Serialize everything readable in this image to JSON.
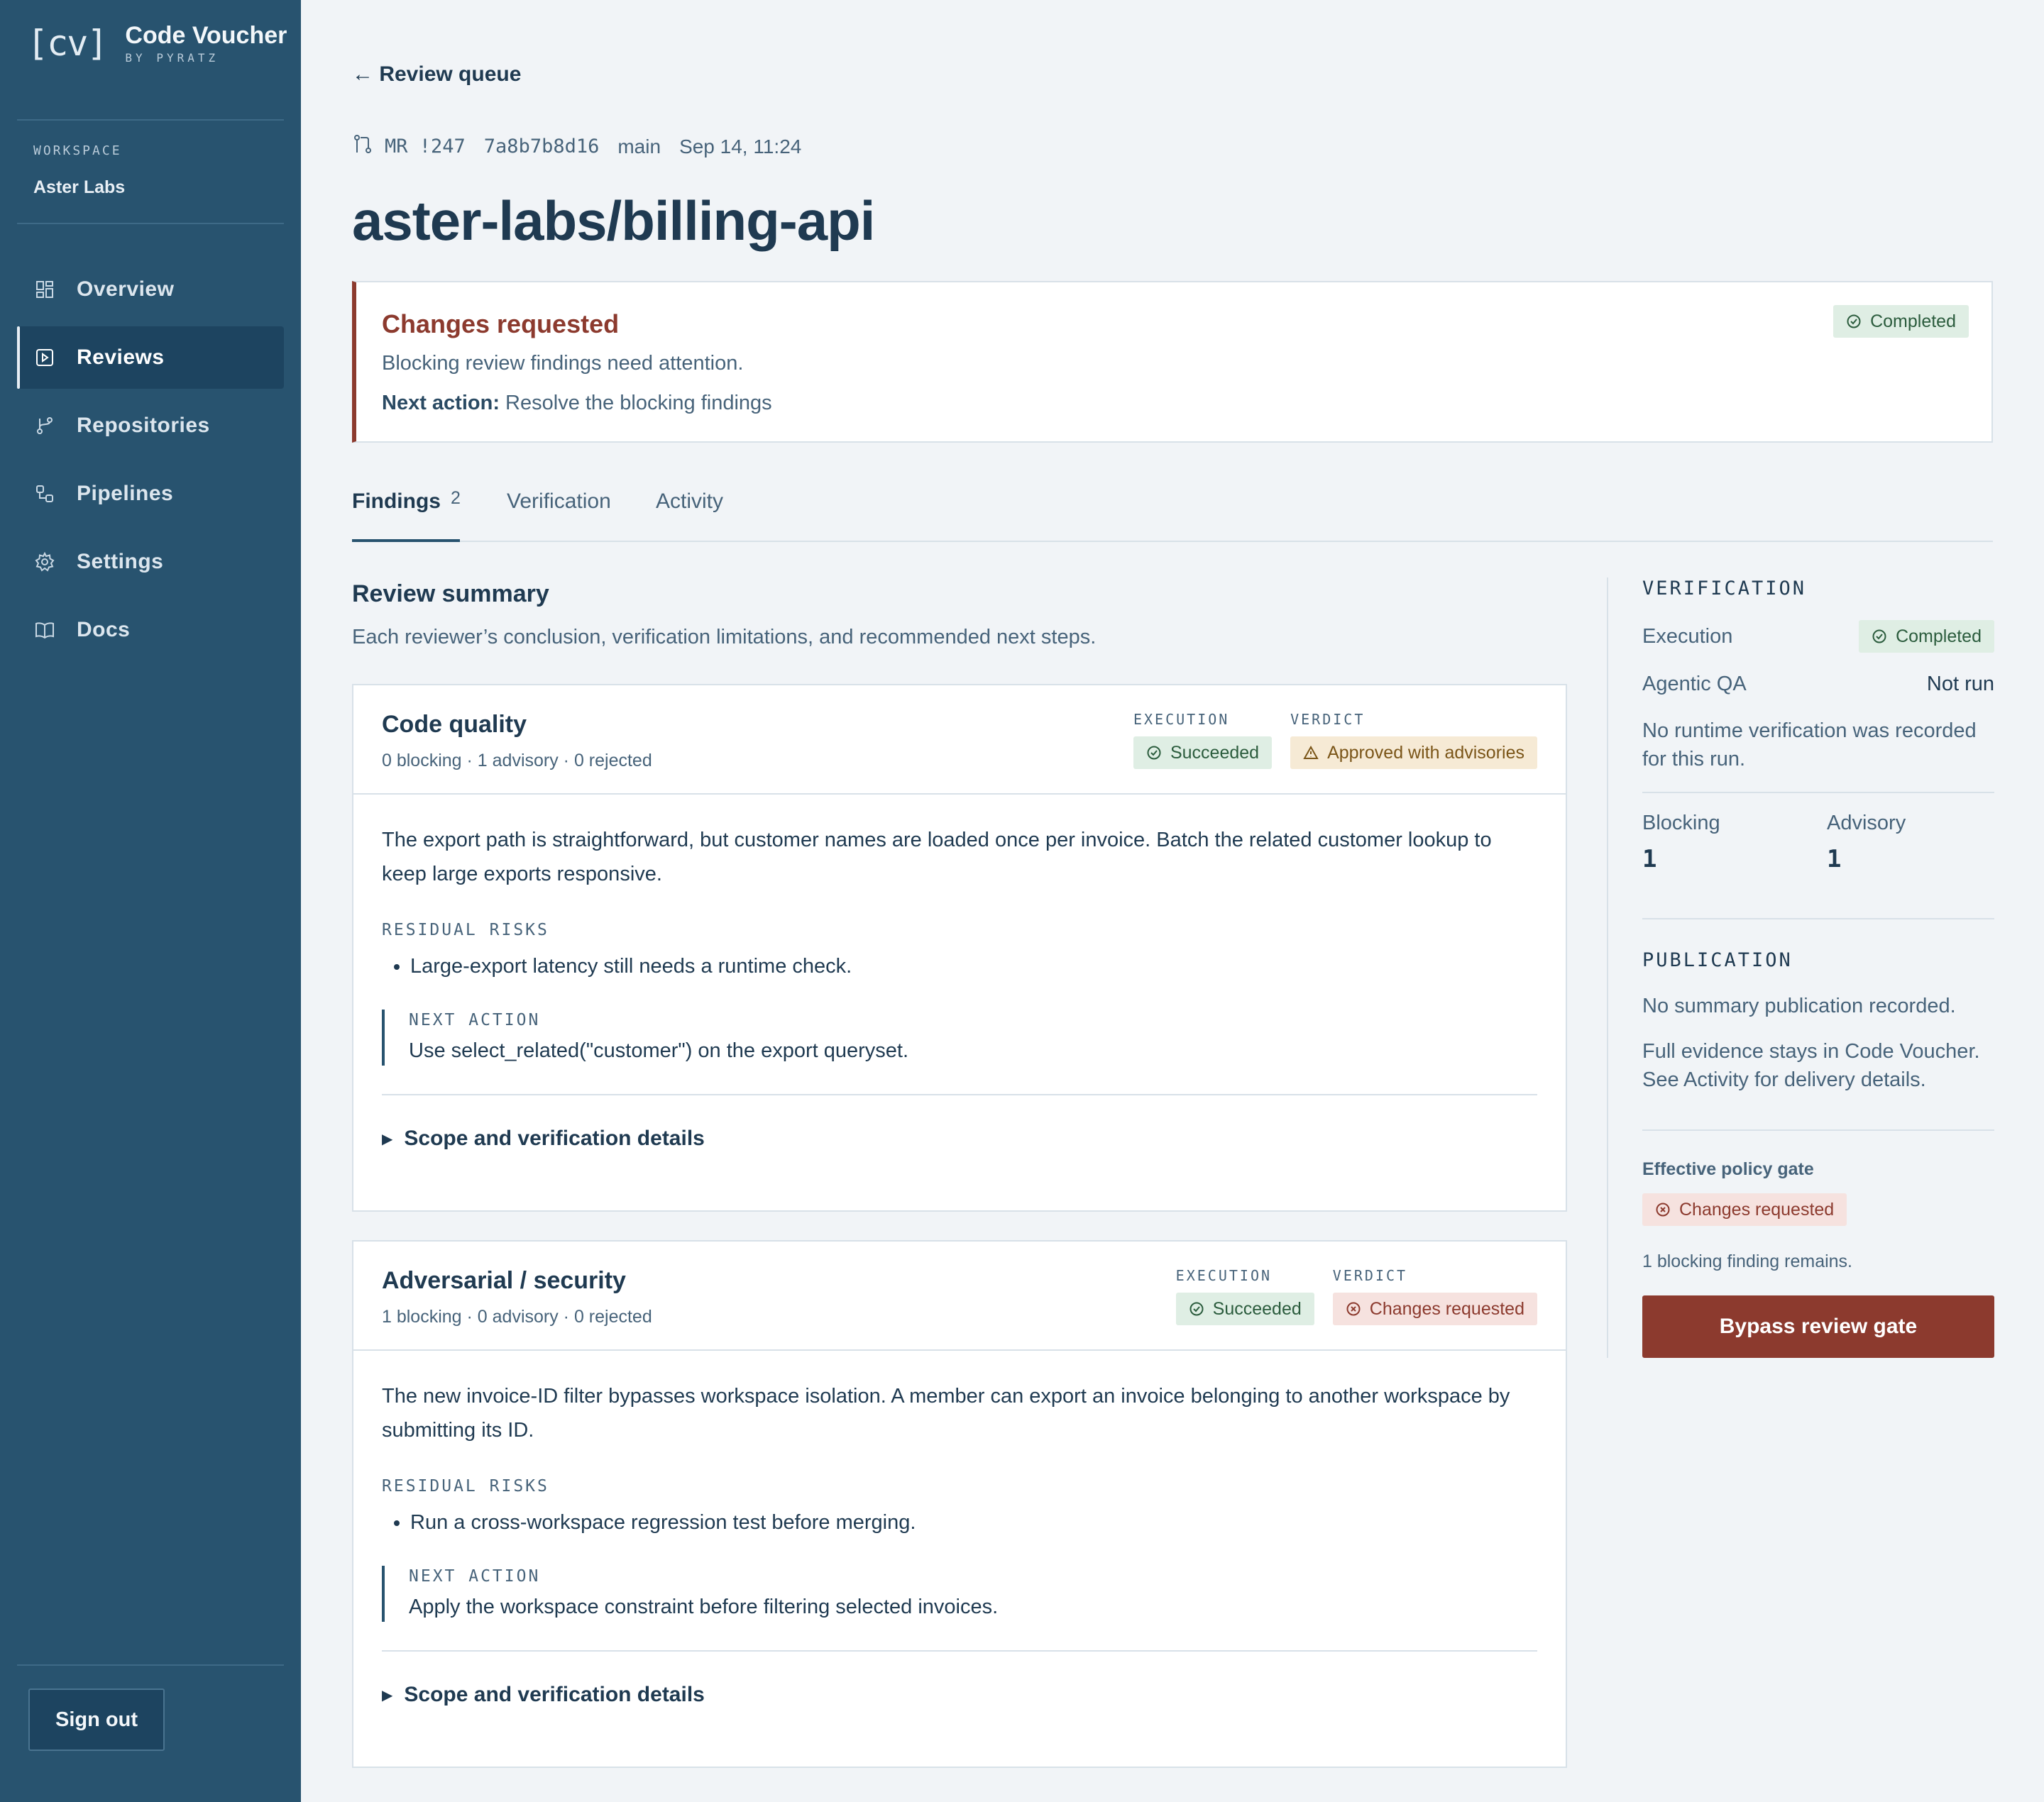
{
  "brand": {
    "logo": "[cv]",
    "title": "Code Voucher",
    "subtitle": "BY PYRATZ"
  },
  "workspace": {
    "label": "WORKSPACE",
    "name": "Aster Labs"
  },
  "nav": [
    {
      "label": "Overview",
      "icon": "dashboard-icon"
    },
    {
      "label": "Reviews",
      "icon": "review-icon",
      "active": true
    },
    {
      "label": "Repositories",
      "icon": "branch-icon"
    },
    {
      "label": "Pipelines",
      "icon": "pipeline-icon"
    },
    {
      "label": "Settings",
      "icon": "gear-icon"
    },
    {
      "label": "Docs",
      "icon": "book-icon"
    }
  ],
  "sign_out": "Sign out",
  "back_link": "← Review queue",
  "meta": {
    "mr": "MR !247",
    "commit": "7a8b7b8d16",
    "branch": "main",
    "date": "Sep 14, 11:24"
  },
  "page_title": "aster-labs/billing-api",
  "status": {
    "title": "Changes requested",
    "description": "Blocking review findings need attention.",
    "next_label": "Next action:",
    "next_value": "Resolve the blocking findings",
    "badge": "Completed"
  },
  "tabs": [
    {
      "label": "Findings",
      "count": "2",
      "active": true
    },
    {
      "label": "Verification"
    },
    {
      "label": "Activity"
    }
  ],
  "summary": {
    "title": "Review summary",
    "description": "Each reviewer’s conclusion, verification limitations, and recommended next steps."
  },
  "reviews": [
    {
      "title": "Code quality",
      "counts": "0 blocking · 1 advisory · 0 rejected",
      "execution_label": "EXECUTION",
      "execution": "Succeeded",
      "verdict_label": "VERDICT",
      "verdict": "Approved with advisories",
      "verdict_tone": "amber",
      "text": "The export path is straightforward, but customer names are loaded once per invoice. Batch the related customer lookup to keep large exports responsive.",
      "risks_label": "RESIDUAL RISKS",
      "risks": [
        "Large-export latency still needs a runtime check."
      ],
      "next_label": "NEXT ACTION",
      "next": "Use select_related(\"customer\") on the export queryset.",
      "scope": "Scope and verification details"
    },
    {
      "title": "Adversarial / security",
      "counts": "1 blocking · 0 advisory · 0 rejected",
      "execution_label": "EXECUTION",
      "execution": "Succeeded",
      "verdict_label": "VERDICT",
      "verdict": "Changes requested",
      "verdict_tone": "red",
      "text": "The new invoice-ID filter bypasses workspace isolation. A member can export an invoice belonging to another workspace by submitting its ID.",
      "risks_label": "RESIDUAL RISKS",
      "risks": [
        "Run a cross-workspace regression test before merging."
      ],
      "next_label": "NEXT ACTION",
      "next": "Apply the workspace constraint before filtering selected invoices.",
      "scope": "Scope and verification details"
    }
  ],
  "verification": {
    "heading": "VERIFICATION",
    "execution_label": "Execution",
    "execution_value": "Completed",
    "agentic_label": "Agentic QA",
    "agentic_value": "Not run",
    "note": "No runtime verification was recorded for this run.",
    "blocking_label": "Blocking",
    "blocking_value": "1",
    "advisory_label": "Advisory",
    "advisory_value": "1"
  },
  "publication": {
    "heading": "PUBLICATION",
    "note1": "No summary publication recorded.",
    "note2": "Full evidence stays in Code Voucher. See Activity for delivery details."
  },
  "policy": {
    "label": "Effective policy gate",
    "badge": "Changes requested",
    "remaining": "1 blocking finding remains.",
    "button": "Bypass review gate"
  },
  "colors": {
    "sidebar": "#28536f",
    "danger": "#8c3a2e",
    "success_bg": "#dfeee4",
    "warning_bg": "#f6ead5"
  }
}
